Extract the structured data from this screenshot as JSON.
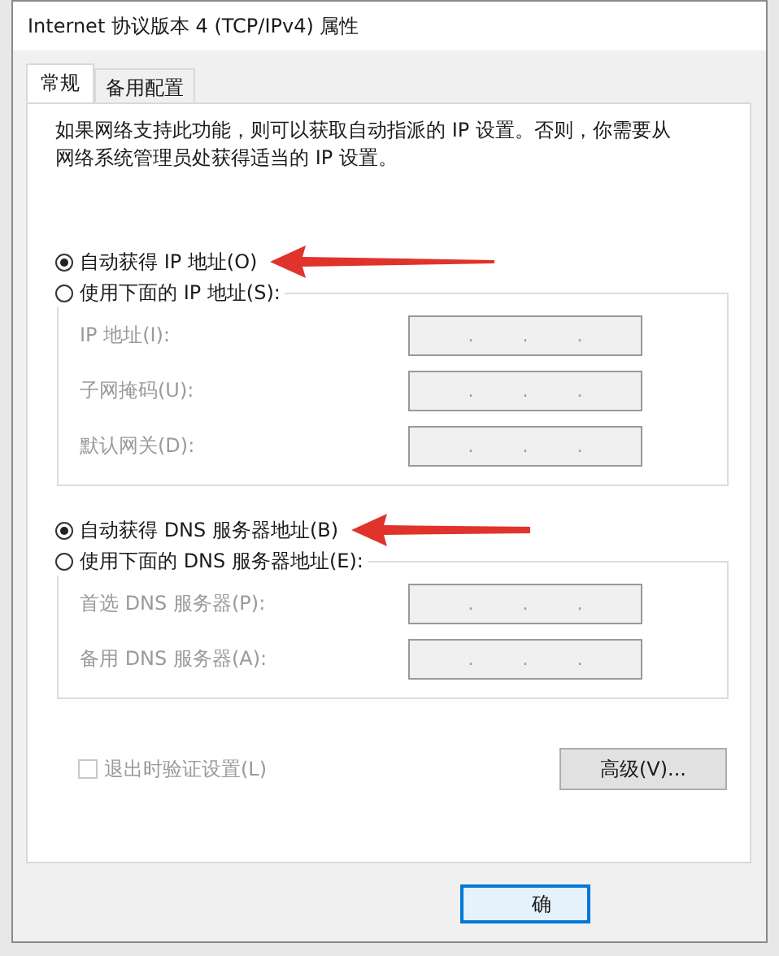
{
  "window": {
    "title": "Internet 协议版本 4 (TCP/IPv4) 属性"
  },
  "tabs": [
    {
      "label": "常规",
      "selected": true
    },
    {
      "label": "备用配置",
      "selected": false
    }
  ],
  "description": "如果网络支持此功能，则可以获取自动指派的 IP 设置。否则，你需要从网络系统管理员处获得适当的 IP 设置。",
  "sections": [
    {
      "auto_radio": {
        "label": "自动获得 IP 地址(O)",
        "selected": true
      },
      "manual_radio": {
        "label": "使用下面的 IP 地址(S):",
        "selected": false
      },
      "fields": [
        {
          "label": "IP 地址(I):",
          "disabled": true,
          "separators": [
            ".",
            ".",
            "."
          ]
        },
        {
          "label": "子网掩码(U):",
          "disabled": true,
          "separators": [
            ".",
            ".",
            "."
          ]
        },
        {
          "label": "默认网关(D):",
          "disabled": true,
          "separators": [
            ".",
            ".",
            "."
          ]
        }
      ]
    },
    {
      "auto_radio": {
        "label": "自动获得 DNS 服务器地址(B)",
        "selected": true
      },
      "manual_radio": {
        "label": "使用下面的 DNS 服务器地址(E):",
        "selected": false
      },
      "fields": [
        {
          "label": "首选 DNS 服务器(P):",
          "disabled": true,
          "separators": [
            ".",
            ".",
            "."
          ]
        },
        {
          "label": "备用 DNS 服务器(A):",
          "disabled": true,
          "separators": [
            ".",
            ".",
            "."
          ]
        }
      ]
    }
  ],
  "validate_checkbox": {
    "label": "退出时验证设置(L)",
    "checked": false,
    "disabled": true
  },
  "advanced_button": "高级(V)...",
  "ok_button": "确"
}
